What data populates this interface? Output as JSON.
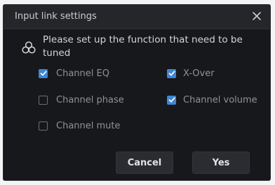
{
  "dialog": {
    "title": "Input link settings",
    "prompt": "Please set up the function that need to be tuned"
  },
  "options": [
    {
      "label": "Channel EQ",
      "checked": true
    },
    {
      "label": "X-Over",
      "checked": true
    },
    {
      "label": "Channel phase",
      "checked": false
    },
    {
      "label": "Channel volume",
      "checked": true
    },
    {
      "label": "Channel mute",
      "checked": false
    }
  ],
  "buttons": {
    "cancel_label": "Cancel",
    "yes_label": "Yes"
  },
  "colors": {
    "accent": "#3f86d3",
    "background": "#17181b",
    "titlebar": "#25262a"
  },
  "icons": {
    "close": "close-icon",
    "prompt": "link-circles-icon",
    "check": "checkmark-icon"
  }
}
